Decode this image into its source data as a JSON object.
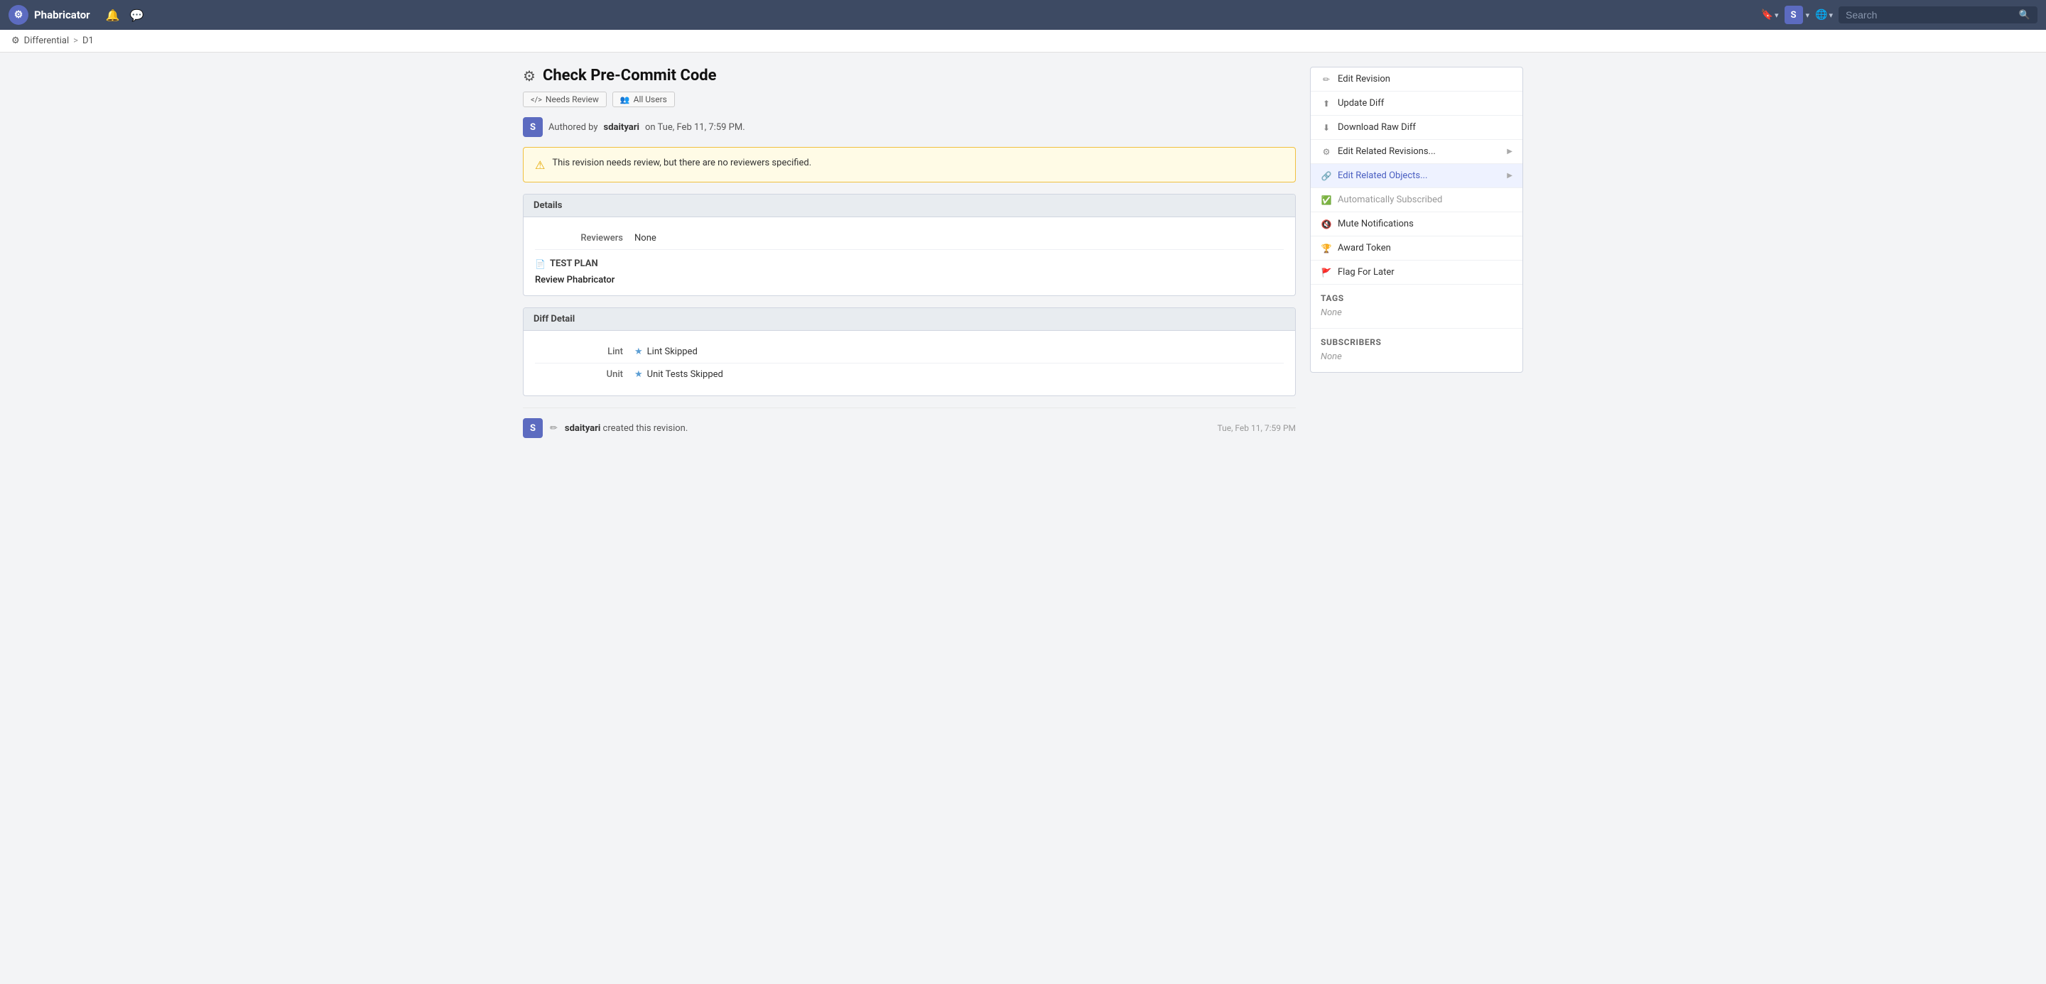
{
  "topnav": {
    "logo_icon": "⚙",
    "app_name": "Phabricator",
    "bell_icon": "🔔",
    "chat_icon": "💬",
    "bookmark_icon": "🔖",
    "user_initial": "S",
    "globe_icon": "🌐",
    "search_placeholder": "Search",
    "search_icon": "🔍"
  },
  "breadcrumb": {
    "icon": "⚙",
    "parent": "Differential",
    "separator": ">",
    "current": "D1"
  },
  "page": {
    "title_icon": "⚙",
    "title": "Check Pre-Commit Code",
    "tags": [
      {
        "icon": "</>",
        "label": "Needs Review"
      },
      {
        "icon": "👥",
        "label": "All Users"
      }
    ],
    "author_initial": "S",
    "authored_by": "Authored by",
    "author_name": "sdaityari",
    "authored_on": "on Tue, Feb 11, 7:59 PM."
  },
  "warning": {
    "icon": "⚠",
    "text": "This revision needs review, but there are no reviewers specified."
  },
  "details": {
    "section_title": "Details",
    "reviewers_label": "Reviewers",
    "reviewers_value": "None",
    "test_plan_icon": "📄",
    "test_plan_label": "TEST PLAN",
    "test_plan_text": "Review Phabricator"
  },
  "diff_detail": {
    "section_title": "Diff Detail",
    "lint_label": "Lint",
    "lint_star": "★",
    "lint_value": "Lint Skipped",
    "unit_label": "Unit",
    "unit_star": "★",
    "unit_value": "Unit Tests Skipped"
  },
  "activity": {
    "user_initial": "S",
    "edit_icon": "✏",
    "user_name": "sdaityari",
    "action": "created this revision.",
    "timestamp": "Tue, Feb 11, 7:59 PM"
  },
  "sidebar": {
    "menu_items": [
      {
        "icon": "✏",
        "label": "Edit Revision",
        "has_arrow": false,
        "active": false,
        "disabled": false
      },
      {
        "icon": "⬆",
        "label": "Update Diff",
        "has_arrow": false,
        "active": false,
        "disabled": false
      },
      {
        "icon": "⬇",
        "label": "Download Raw Diff",
        "has_arrow": false,
        "active": false,
        "disabled": false
      },
      {
        "icon": "⚙",
        "label": "Edit Related Revisions...",
        "has_arrow": true,
        "active": false,
        "disabled": false
      },
      {
        "icon": "🔗",
        "label": "Edit Related Objects...",
        "has_arrow": true,
        "active": true,
        "disabled": false
      },
      {
        "icon": "✅",
        "label": "Automatically Subscribed",
        "has_arrow": false,
        "active": false,
        "disabled": true
      },
      {
        "icon": "🔇",
        "label": "Mute Notifications",
        "has_arrow": false,
        "active": false,
        "disabled": false
      },
      {
        "icon": "🏆",
        "label": "Award Token",
        "has_arrow": false,
        "active": false,
        "disabled": false
      },
      {
        "icon": "🚩",
        "label": "Flag For Later",
        "has_arrow": false,
        "active": false,
        "disabled": false
      }
    ],
    "tags_title": "Tags",
    "tags_value": "None",
    "subscribers_title": "Subscribers",
    "subscribers_value": "None"
  }
}
